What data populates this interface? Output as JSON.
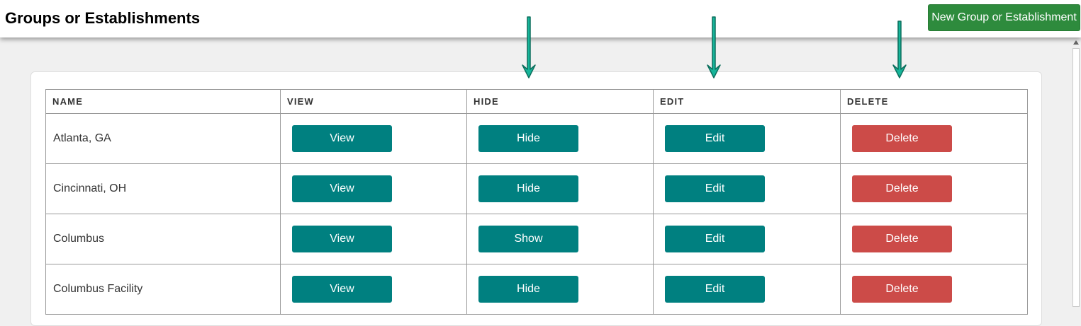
{
  "header": {
    "title": "Groups or Establishments",
    "new_button_label": "New Group or Establishment"
  },
  "table": {
    "columns": [
      "NAME",
      "VIEW",
      "HIDE",
      "EDIT",
      "DELETE"
    ],
    "rows": [
      {
        "name": "Atlanta, GA",
        "view": "View",
        "hide": "Hide",
        "edit": "Edit",
        "delete": "Delete"
      },
      {
        "name": "Cincinnati, OH",
        "view": "View",
        "hide": "Hide",
        "edit": "Edit",
        "delete": "Delete"
      },
      {
        "name": "Columbus",
        "view": "View",
        "hide": "Show",
        "edit": "Edit",
        "delete": "Delete"
      },
      {
        "name": "Columbus Facility",
        "view": "View",
        "hide": "Hide",
        "edit": "Edit",
        "delete": "Delete"
      }
    ]
  },
  "annotations": {
    "arrows": [
      "arrow-down-icon",
      "arrow-down-icon",
      "arrow-down-icon"
    ],
    "arrow_color": "#16b59a"
  },
  "colors": {
    "primary_button": "#008080",
    "danger_button": "#cc4b48",
    "new_button": "#2e8b3d"
  }
}
